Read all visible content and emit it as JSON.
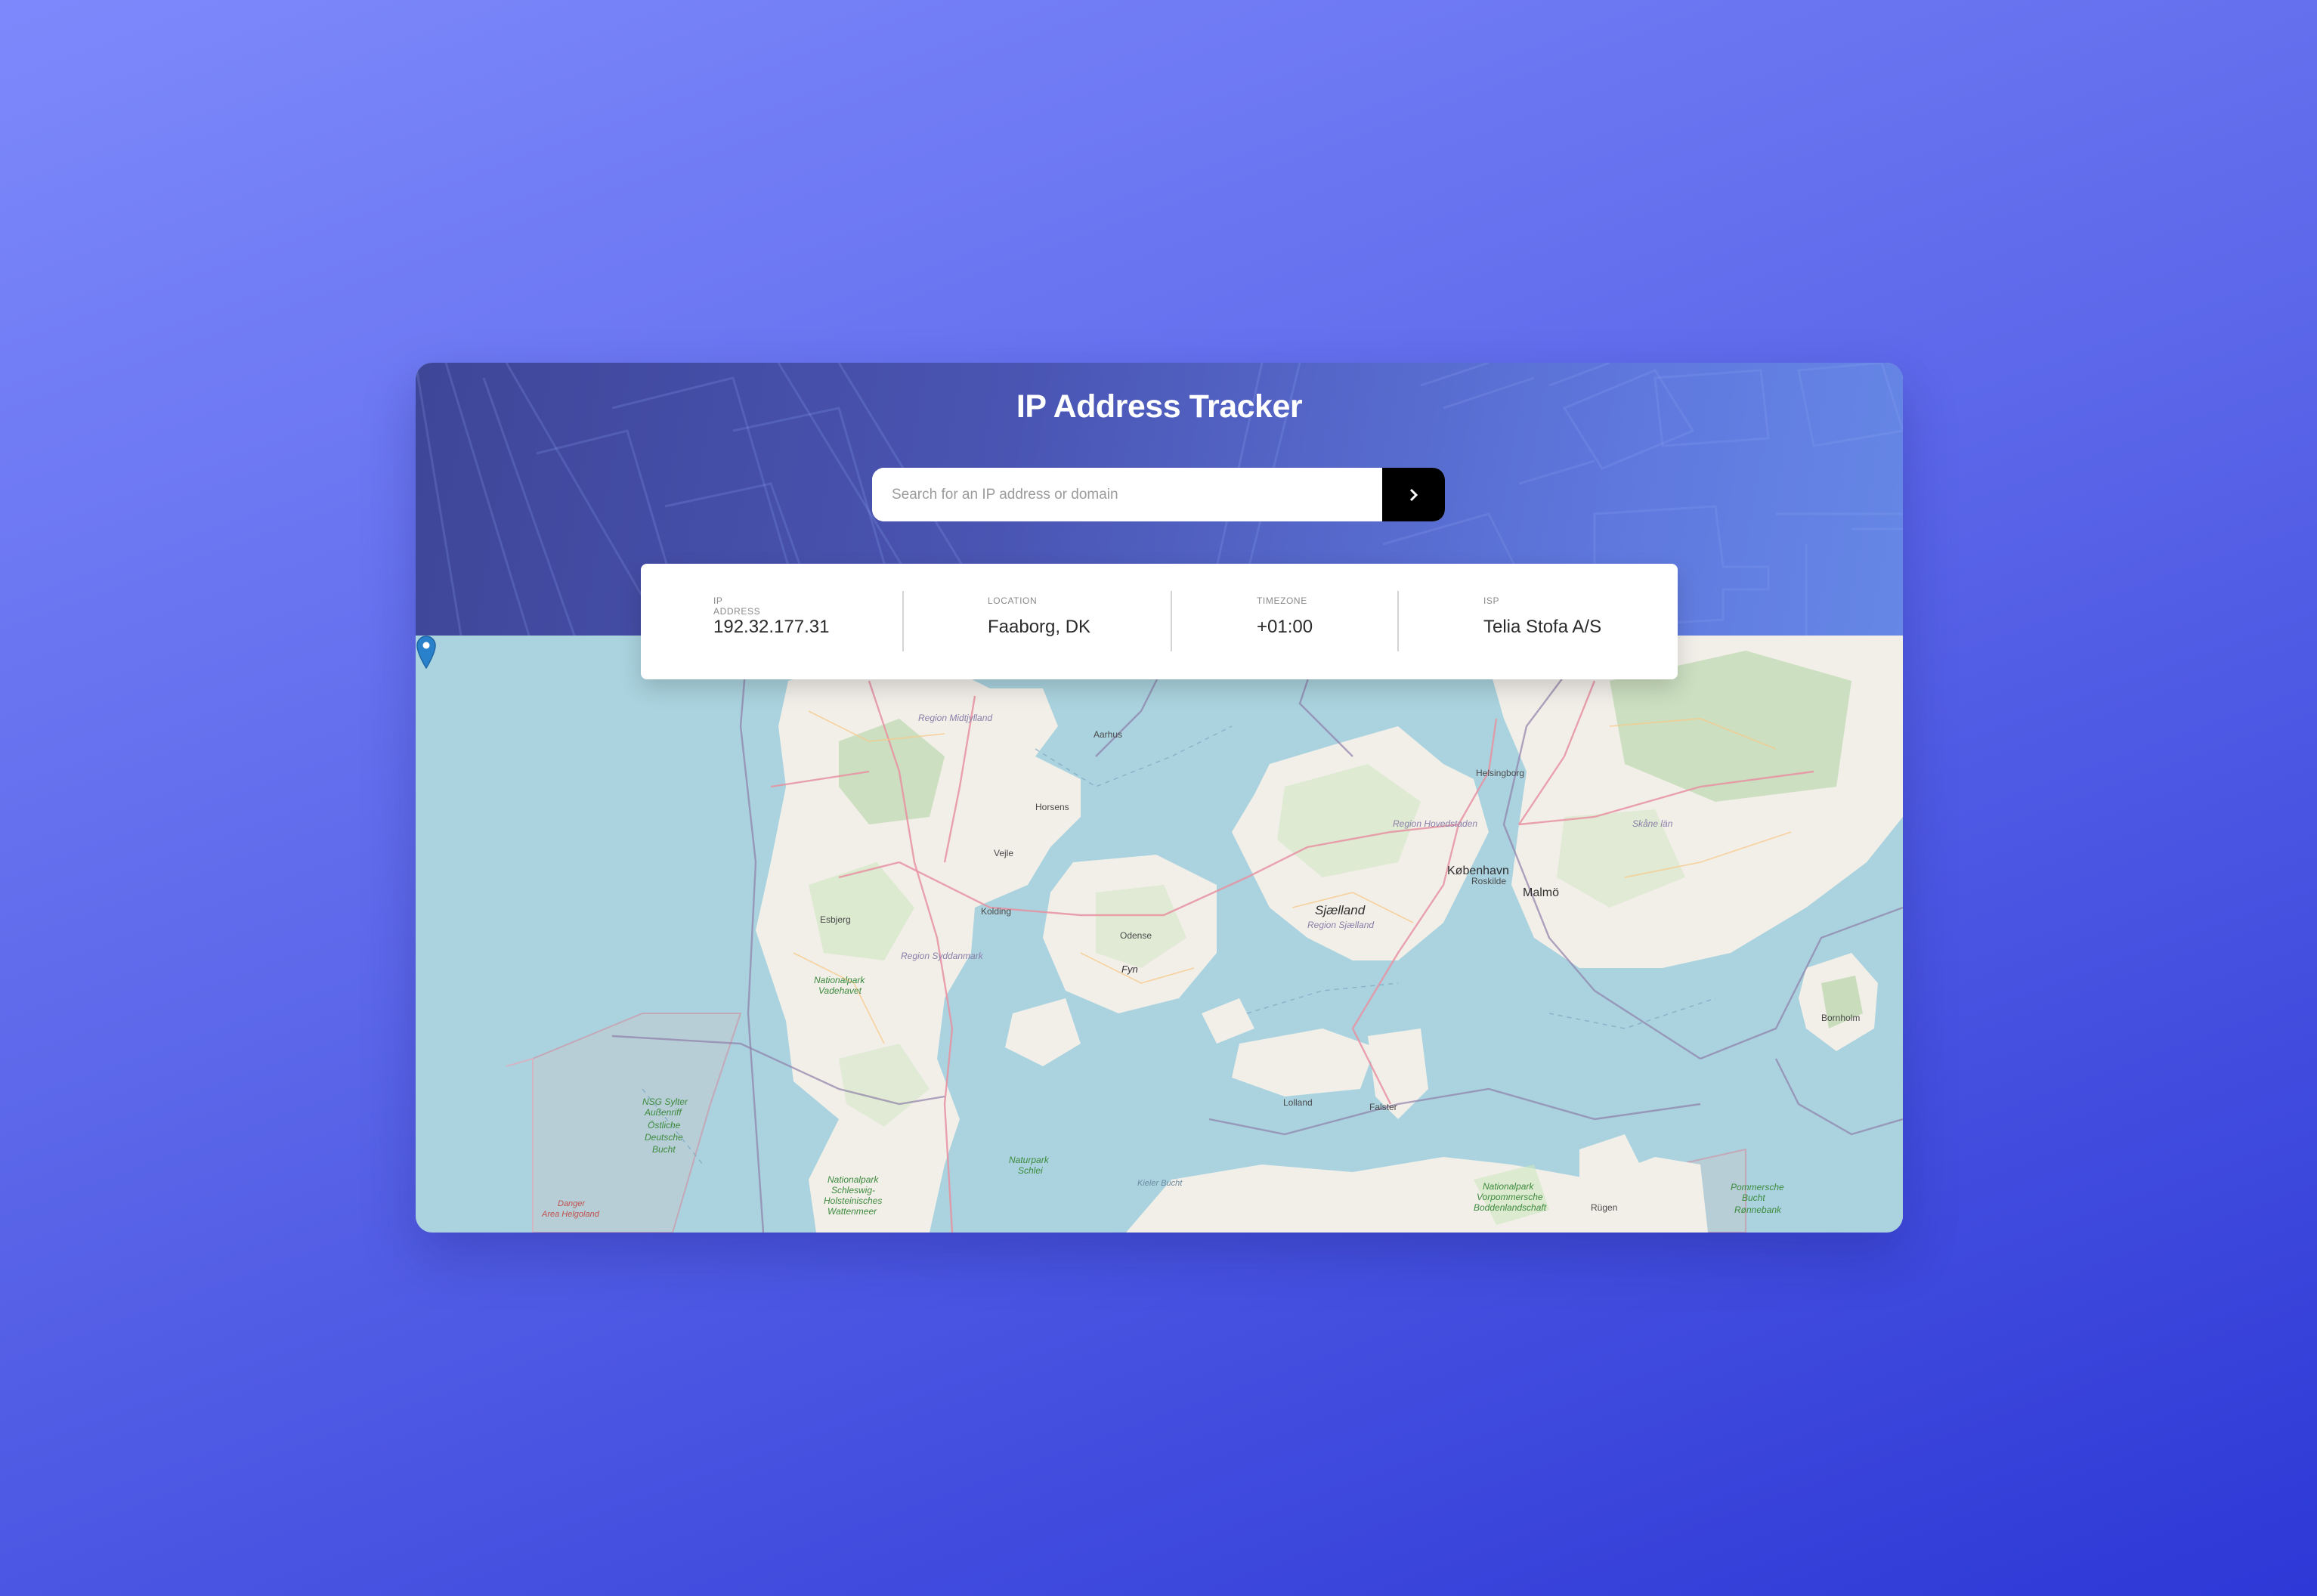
{
  "app": {
    "title": "IP Address Tracker"
  },
  "search": {
    "placeholder": "Search for an IP address or domain",
    "value": ""
  },
  "info": {
    "ip_label": "IP ADDRESS",
    "ip_value": "192.32.177.31",
    "location_label": "LOCATION",
    "location_value": "Faaborg, DK",
    "timezone_label": "TIMEZONE",
    "timezone_value": "+01:00",
    "isp_label": "ISP",
    "isp_value": "Telia Stofa A/S"
  },
  "map": {
    "labels": {
      "midtjylland": "Region Midtjylland",
      "aarhus": "Aarhus",
      "horsens": "Horsens",
      "vejle": "Vejle",
      "kolding": "Kolding",
      "esbjerg": "Esbjerg",
      "syddanmark": "Region Syddanmark",
      "fyn": "Fyn",
      "odense": "Odense",
      "sjaelland": "Sjælland",
      "region_sjaelland": "Region Sjælland",
      "hovedstaden": "Region Hovedstaden",
      "kobenhavn": "København",
      "malmo": "Malmö",
      "helsingborg": "Helsingborg",
      "roskilde": "Roskilde",
      "skane": "Skåne län",
      "bornholm": "Bornholm",
      "lolland": "Lolland",
      "falster": "Falster",
      "rugen": "Rügen",
      "np_vadehavet_1": "Nationalpark",
      "np_vadehavet_2": "Vadehavet",
      "nsg_1": "NSG Sylter",
      "nsg_2": "Außenriff",
      "nsg_3": "Östliche",
      "nsg_4": "Deutsche",
      "nsg_5": "Bucht",
      "danger_1": "Danger",
      "danger_2": "Area Helgoland",
      "np_sh_1": "Nationalpark",
      "np_sh_2": "Schleswig-",
      "np_sh_3": "Holsteinisches",
      "np_sh_4": "Wattenmeer",
      "np_schlei_1": "Naturpark",
      "np_schlei_2": "Schlei",
      "pommersche_1": "Pommersche",
      "pommersche_2": "Bucht",
      "pommersche_3": "Rønnebank",
      "vorpommern_1": "Nationalpark",
      "vorpommern_2": "Vorpommersche",
      "vorpommern_3": "Boddenlandschaft",
      "kieler": "Kieler Bucht"
    }
  },
  "colors": {
    "accent_dark": "#000000",
    "header_start": "#3e4698",
    "header_end": "#6687e6",
    "marker": "#2a81cb"
  },
  "icons": {
    "submit": "chevron-right-icon",
    "marker": "map-pin-icon"
  }
}
